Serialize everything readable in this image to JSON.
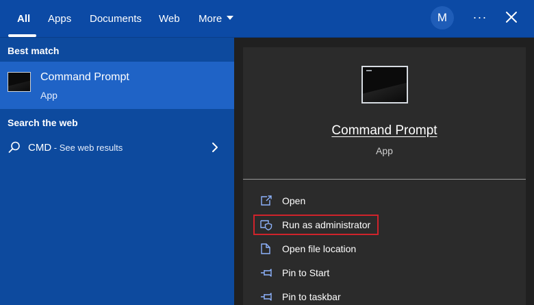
{
  "topbar": {
    "tabs": [
      {
        "label": "All"
      },
      {
        "label": "Apps"
      },
      {
        "label": "Documents"
      },
      {
        "label": "Web"
      },
      {
        "label": "More"
      }
    ],
    "avatar_initial": "M",
    "more_options": "···"
  },
  "left": {
    "best_match_heading": "Best match",
    "best_match": {
      "title": "Command Prompt",
      "subtitle": "App"
    },
    "search_web_heading": "Search the web",
    "web_result": {
      "query": "CMD",
      "suffix": " - See web results"
    }
  },
  "detail": {
    "title": "Command Prompt",
    "subtitle": "App",
    "actions": [
      {
        "label": "Open",
        "icon": "open-icon"
      },
      {
        "label": "Run as administrator",
        "icon": "shield-icon"
      },
      {
        "label": "Open file location",
        "icon": "folder-icon"
      },
      {
        "label": "Pin to Start",
        "icon": "pin-icon"
      },
      {
        "label": "Pin to taskbar",
        "icon": "pin-icon"
      }
    ]
  },
  "colors": {
    "accent": "#0d4a9e",
    "selected": "#1f63c6",
    "panel": "#2b2b2b",
    "highlight": "#d0232b"
  }
}
